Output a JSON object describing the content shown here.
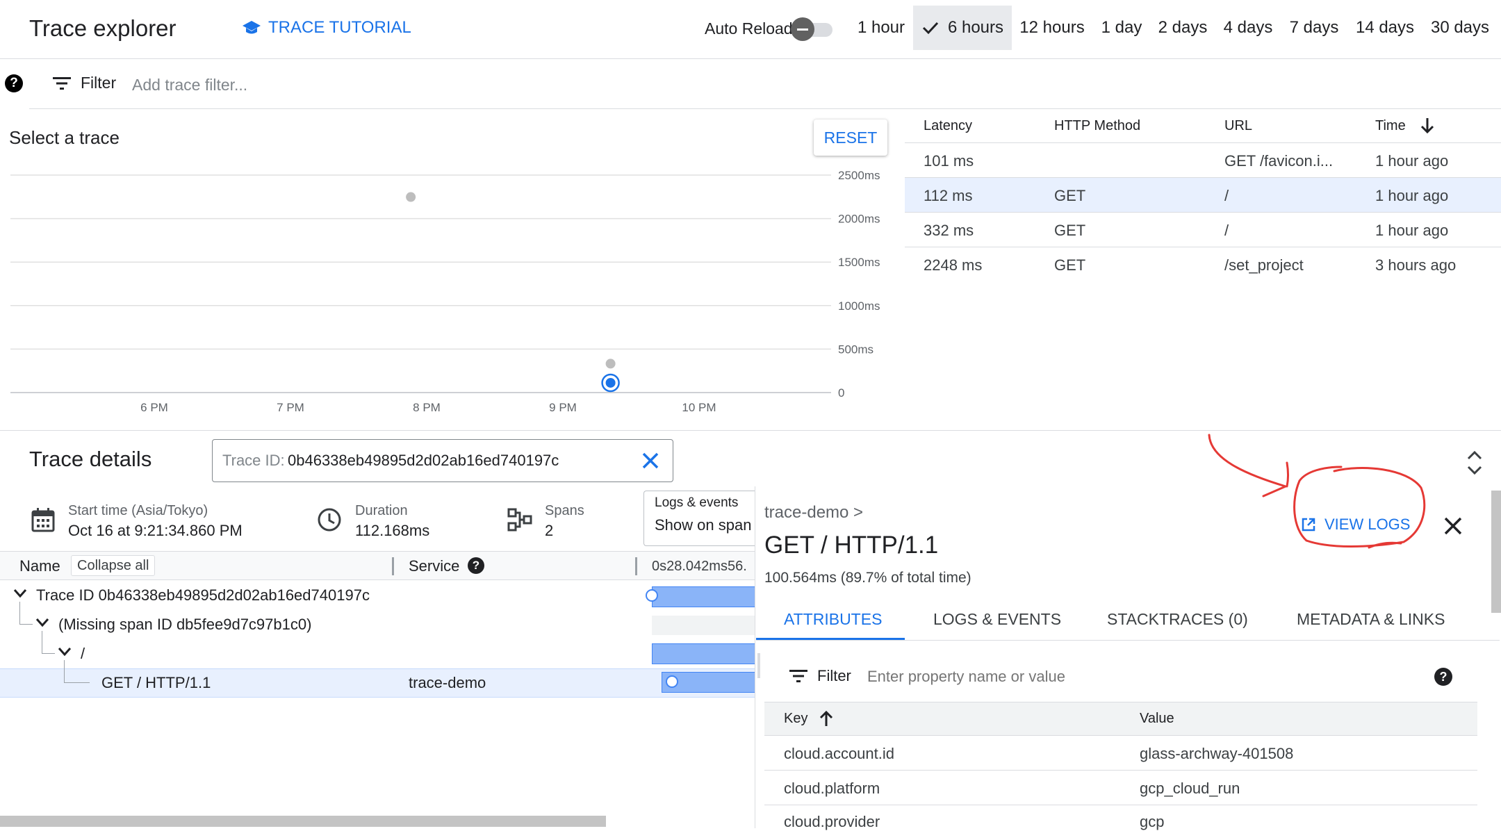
{
  "header": {
    "title": "Trace explorer",
    "tutorial_label": "TRACE TUTORIAL",
    "auto_reload_label": "Auto Reload",
    "auto_reload_on": false,
    "time_ranges": [
      "1 hour",
      "6 hours",
      "12 hours",
      "1 day",
      "2 days",
      "4 days",
      "7 days",
      "14 days",
      "30 days"
    ],
    "selected_range": "6 hours"
  },
  "filter_bar": {
    "label": "Filter",
    "placeholder": "Add trace filter..."
  },
  "scatter": {
    "heading": "Select a trace",
    "reset_label": "RESET"
  },
  "chart_data": {
    "type": "scatter",
    "title": "",
    "xlabel": "",
    "ylabel": "",
    "x_ticks": [
      "6 PM",
      "7 PM",
      "8 PM",
      "9 PM",
      "10 PM"
    ],
    "y_ticks": [
      "2500ms",
      "2000ms",
      "1500ms",
      "1000ms",
      "500ms",
      "0"
    ],
    "ylim": [
      0,
      2500
    ],
    "grid": true,
    "points": [
      {
        "time": "7:53 PM",
        "latency_ms": 2248,
        "selected": false
      },
      {
        "time": "9:21 PM",
        "latency_ms": 332,
        "selected": false
      },
      {
        "time": "9:21 PM",
        "latency_ms": 112,
        "selected": true
      }
    ],
    "colors": {
      "point": "#bdbdbd",
      "selected": "#1a73e8",
      "grid": "#e0e0e0"
    }
  },
  "trace_table": {
    "columns": [
      "Latency",
      "HTTP Method",
      "URL",
      "Time"
    ],
    "sort_column": "Time",
    "sort_direction": "descending",
    "rows": [
      {
        "latency": "101 ms",
        "method": "",
        "url": "GET /favicon.i...",
        "time": "1 hour ago"
      },
      {
        "latency": "112 ms",
        "method": "GET",
        "url": "/",
        "time": "1 hour ago"
      },
      {
        "latency": "332 ms",
        "method": "GET",
        "url": "/",
        "time": "1 hour ago"
      },
      {
        "latency": "2248 ms",
        "method": "GET",
        "url": "/set_project",
        "time": "3 hours ago"
      }
    ],
    "selected_row": 1
  },
  "details": {
    "title": "Trace details",
    "trace_id_label": "Trace ID:",
    "trace_id_value": "0b46338eb49895d2d02ab16ed740197c",
    "start_label": "Start time (Asia/Tokyo)",
    "start_value": "Oct 16 at 9:21:34.860 PM",
    "duration_label": "Duration",
    "duration_value": "112.168ms",
    "spans_label": "Spans",
    "spans_value": "2",
    "logs_label": "Logs & events",
    "logs_value": "Show on span",
    "col_name": "Name",
    "collapse_all": "Collapse all",
    "col_service": "Service",
    "timeline_header": "0s28.042ms56.",
    "tree": [
      {
        "label": "Trace ID 0b46338eb49895d2d02ab16ed740197c",
        "service": "",
        "depth": 0
      },
      {
        "label": "(Missing span ID db5fee9d7c97b1c0)",
        "service": "",
        "depth": 1
      },
      {
        "label": "/",
        "service": "",
        "depth": 2
      },
      {
        "label": "GET / HTTP/1.1",
        "service": "trace-demo",
        "depth": 3
      }
    ]
  },
  "span_panel": {
    "breadcrumb": "trace-demo >",
    "title": "GET / HTTP/1.1",
    "timing": "100.564ms (89.7% of total time)",
    "view_logs": "VIEW LOGS",
    "tabs": [
      "ATTRIBUTES",
      "LOGS & EVENTS",
      "STACKTRACES (0)",
      "METADATA & LINKS"
    ],
    "active_tab": "ATTRIBUTES",
    "filter_label": "Filter",
    "filter_placeholder": "Enter property name or value",
    "key_header": "Key",
    "value_header": "Value",
    "attributes": [
      {
        "key": "cloud.account.id",
        "value": "glass-archway-401508"
      },
      {
        "key": "cloud.platform",
        "value": "gcp_cloud_run"
      },
      {
        "key": "cloud.provider",
        "value": "gcp"
      }
    ]
  },
  "annotation": {
    "color": "#e53935"
  }
}
